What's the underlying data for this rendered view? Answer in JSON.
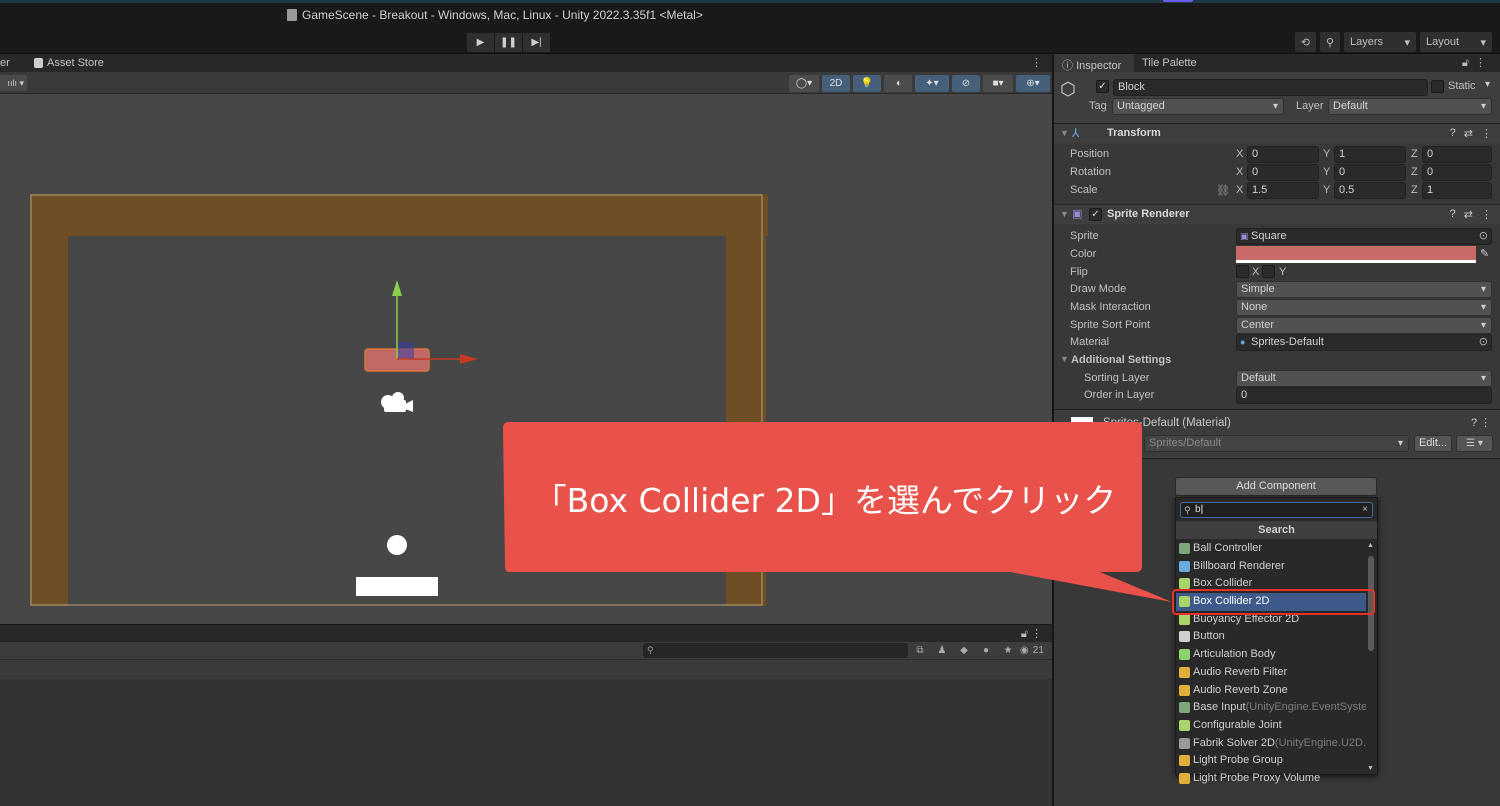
{
  "window": {
    "title": "GameScene - Breakout - Windows, Mac, Linux - Unity 2022.3.35f1 <Metal>"
  },
  "toolbar": {
    "play_icon": "play-icon",
    "pause_icon": "pause-icon",
    "step_icon": "step-icon",
    "layers_label": "Layers",
    "layout_label": "Layout"
  },
  "scene_panel": {
    "tabs": [
      {
        "label": "er"
      },
      {
        "label": "Asset Store"
      }
    ],
    "toolbar": {
      "mode_2d_label": "2D"
    }
  },
  "scene": {
    "wall_color": "#6e4e24",
    "background_color": "#474747",
    "selected_block_color": "#c86b68"
  },
  "console": {
    "search_placeholder": "",
    "message_count": "21"
  },
  "inspector": {
    "tabs": [
      {
        "label": "Inspector",
        "active": true
      },
      {
        "label": "Tile Palette",
        "active": false
      }
    ],
    "gameobject": {
      "active": true,
      "name": "Block",
      "static_label": "Static",
      "static": false,
      "tag_label": "Tag",
      "tag": "Untagged",
      "layer_label": "Layer",
      "layer": "Default"
    },
    "transform": {
      "title": "Transform",
      "position_label": "Position",
      "rotation_label": "Rotation",
      "scale_label": "Scale",
      "position": {
        "x": "0",
        "y": "1",
        "z": "0"
      },
      "rotation": {
        "x": "0",
        "y": "0",
        "z": "0"
      },
      "scale": {
        "x": "1.5",
        "y": "0.5",
        "z": "1"
      },
      "axis_x": "X",
      "axis_y": "Y",
      "axis_z": "Z"
    },
    "sprite_renderer": {
      "title": "Sprite Renderer",
      "enabled": true,
      "sprite_label": "Sprite",
      "sprite": "Square",
      "color_label": "Color",
      "color": "#c86b68",
      "flip_label": "Flip",
      "flip_x_label": "X",
      "flip_y_label": "Y",
      "draw_mode_label": "Draw Mode",
      "draw_mode": "Simple",
      "mask_interaction_label": "Mask Interaction",
      "mask_interaction": "None",
      "sort_point_label": "Sprite Sort Point",
      "sort_point": "Center",
      "material_label": "Material",
      "material": "Sprites-Default",
      "additional_settings_label": "Additional Settings",
      "sorting_layer_label": "Sorting Layer",
      "sorting_layer": "Default",
      "order_label": "Order in Layer",
      "order": "0"
    },
    "material": {
      "title": "Sprites-Default (Material)",
      "shader": "Sprites/Default",
      "edit_label": "Edit..."
    },
    "add_component": {
      "button_label": "Add Component",
      "search_value": "b",
      "search_header": "Search",
      "items": [
        {
          "label": "Ball Controller",
          "ns": "",
          "icon": "script-icon",
          "color": "#7fa77c",
          "selected": false
        },
        {
          "label": "Billboard Renderer",
          "ns": "",
          "icon": "billboard-icon",
          "color": "#6aa8e0",
          "selected": false
        },
        {
          "label": "Box Collider",
          "ns": "",
          "icon": "box-collider-icon",
          "color": "#a8d46a",
          "selected": false
        },
        {
          "label": "Box Collider 2D",
          "ns": "",
          "icon": "box-collider-2d-icon",
          "color": "#a8d46a",
          "selected": true
        },
        {
          "label": "Buoyancy Effector 2D",
          "ns": "",
          "icon": "buoyancy-icon",
          "color": "#a8d46a",
          "selected": false
        },
        {
          "label": "Button",
          "ns": "",
          "icon": "button-icon",
          "color": "#cfcfcf",
          "selected": false
        },
        {
          "label": "Articulation Body",
          "ns": "",
          "icon": "articulation-icon",
          "color": "#8ad46a",
          "selected": false
        },
        {
          "label": "Audio Reverb Filter",
          "ns": "",
          "icon": "audio-reverb-filter-icon",
          "color": "#e0b03a",
          "selected": false
        },
        {
          "label": "Audio Reverb Zone",
          "ns": "",
          "icon": "audio-reverb-zone-icon",
          "color": "#e0b03a",
          "selected": false
        },
        {
          "label": "Base Input",
          "ns": "(UnityEngine.EventSyste",
          "icon": "script-icon",
          "color": "#7fa77c",
          "selected": false
        },
        {
          "label": "Configurable Joint",
          "ns": "",
          "icon": "joint-icon",
          "color": "#a8d46a",
          "selected": false
        },
        {
          "label": "Fabrik Solver 2D",
          "ns": "(UnityEngine.U2D.",
          "icon": "ik-solver-icon",
          "color": "#9a9a9a",
          "selected": false
        },
        {
          "label": "Light Probe Group",
          "ns": "",
          "icon": "light-probe-icon",
          "color": "#e0b03a",
          "selected": false
        },
        {
          "label": "Light Probe Proxy Volume",
          "ns": "",
          "icon": "light-probe-proxy-icon",
          "color": "#e0b03a",
          "selected": false
        }
      ]
    }
  },
  "annotation": {
    "text": "「Box Collider 2D」を選んでクリック",
    "color": "#e8524a"
  }
}
